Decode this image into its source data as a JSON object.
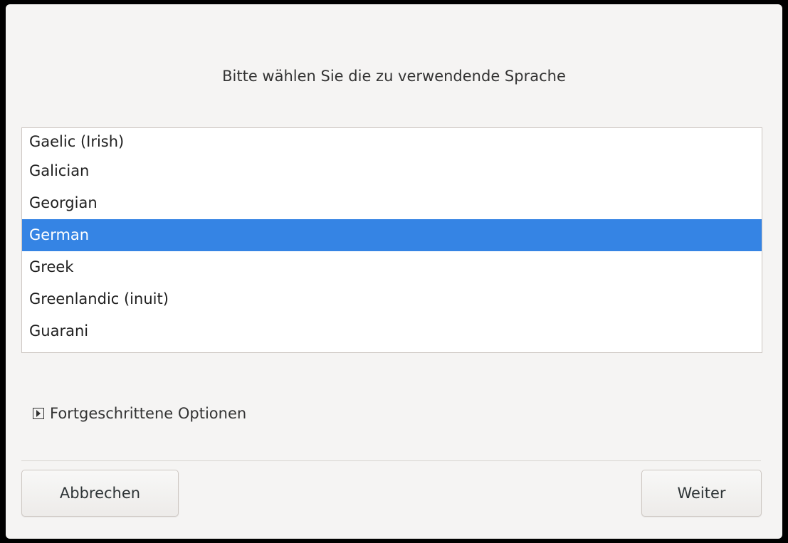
{
  "dialog": {
    "title": "Bitte wählen Sie die zu verwendende Sprache"
  },
  "language_list": {
    "items": [
      {
        "label": "Gaelic (Irish)",
        "selected": false
      },
      {
        "label": "Galician",
        "selected": false
      },
      {
        "label": "Georgian",
        "selected": false
      },
      {
        "label": "German",
        "selected": true
      },
      {
        "label": "Greek",
        "selected": false
      },
      {
        "label": "Greenlandic (inuit)",
        "selected": false
      },
      {
        "label": "Guarani",
        "selected": false
      }
    ]
  },
  "advanced_options": {
    "label": "Fortgeschrittene Optionen",
    "icon": "expander-right-icon",
    "expanded": false
  },
  "buttons": {
    "cancel_label": "Abbrechen",
    "next_label": "Weiter"
  },
  "colors": {
    "selection": "#3584e4",
    "background": "#f5f4f3"
  }
}
